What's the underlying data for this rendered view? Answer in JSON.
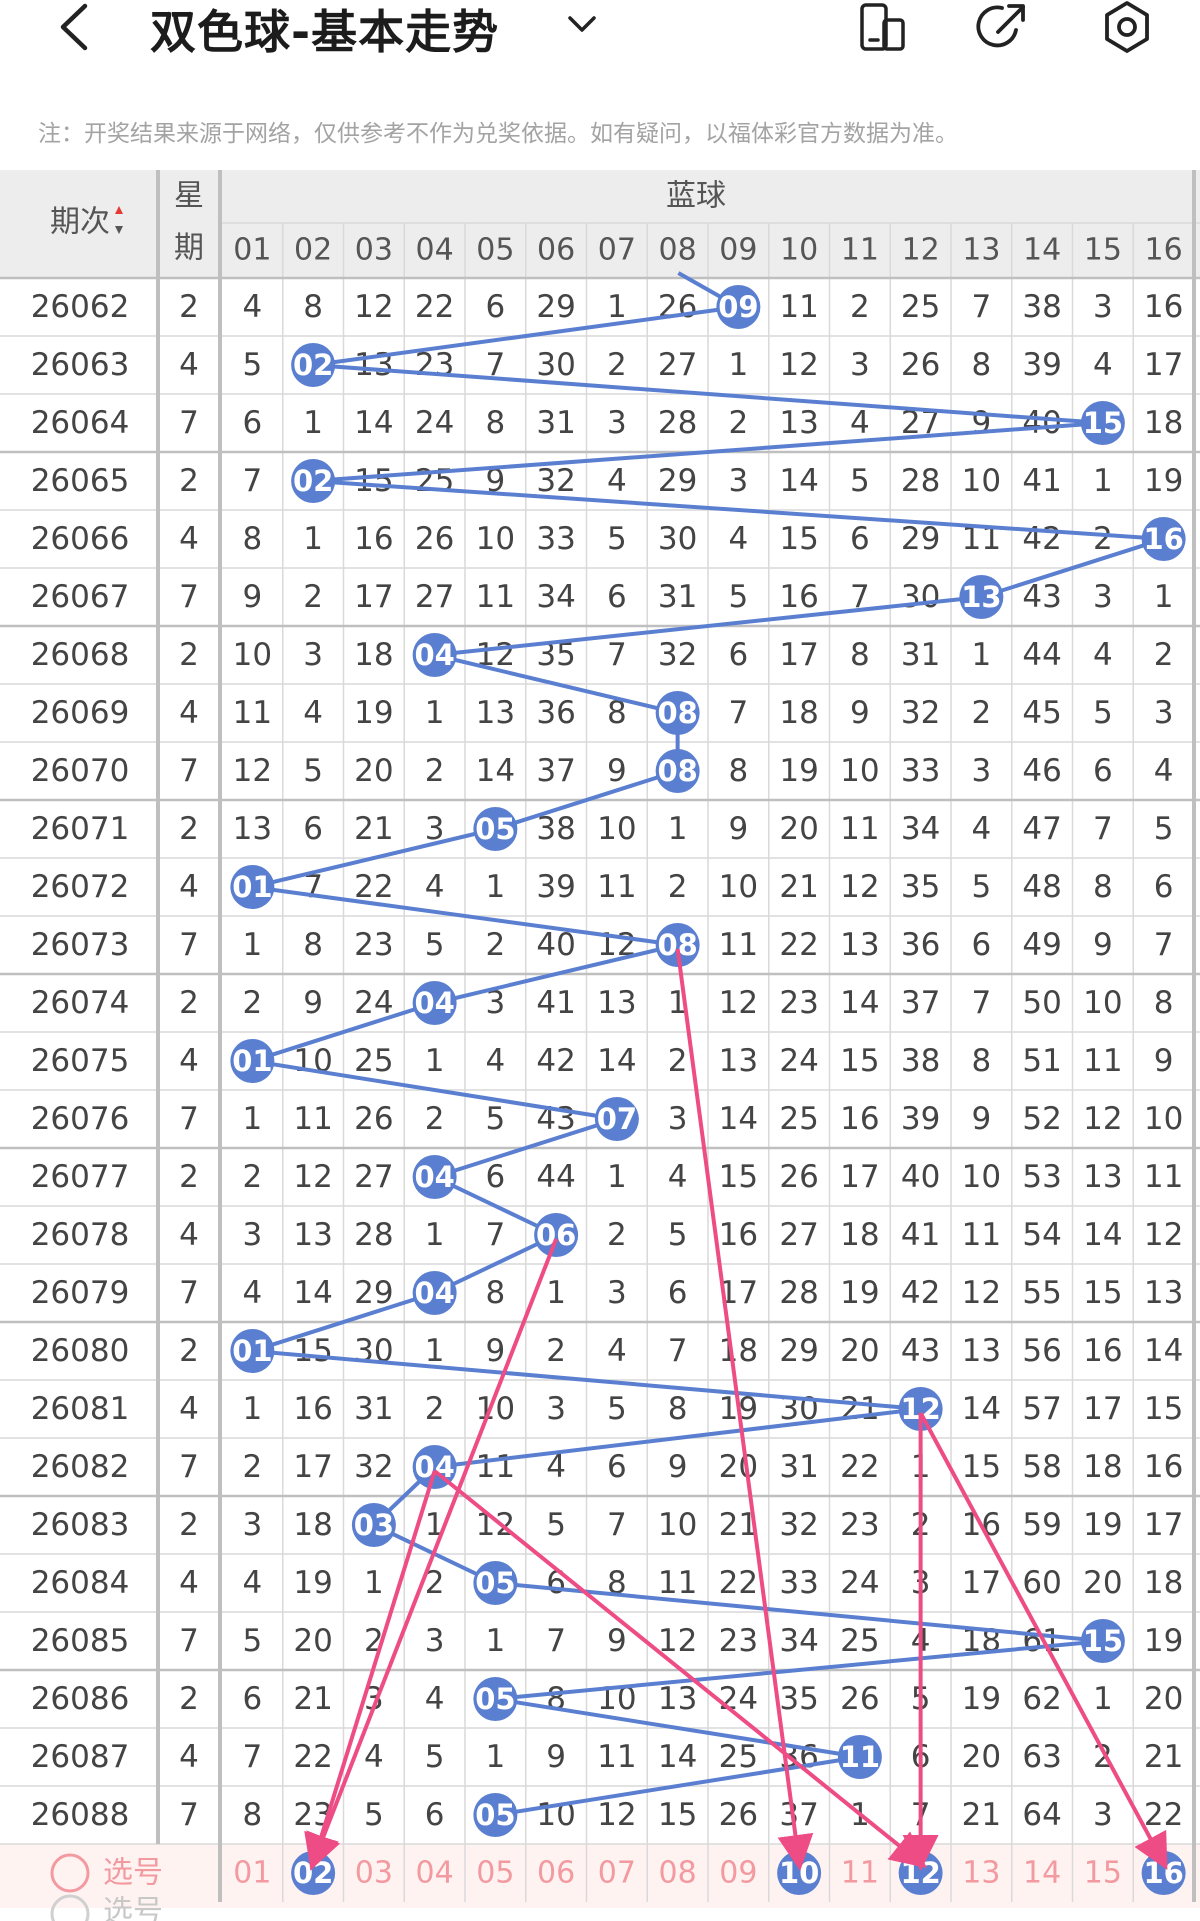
{
  "header": {
    "back_icon": "chevron-left-icon",
    "title": "双色球-基本走势",
    "dropdown_icon": "chevron-down-icon",
    "actions": [
      "phone-layout-icon",
      "share-icon",
      "settings-icon"
    ]
  },
  "notice": "注：开奖结果来源于网络，仅供参考不作为兑奖依据。如有疑问，以福体彩官方数据为准。",
  "table": {
    "col_issue": "期次",
    "col_week_1": "星",
    "col_week_2": "期",
    "group_title": "蓝球",
    "columns": [
      "01",
      "02",
      "03",
      "04",
      "05",
      "06",
      "07",
      "08",
      "09",
      "10",
      "11",
      "12",
      "13",
      "14",
      "15",
      "16"
    ],
    "rows": [
      {
        "issue": "26062",
        "week": "2",
        "cells": [
          "4",
          "8",
          "12",
          "22",
          "6",
          "29",
          "1",
          "26",
          "09",
          "11",
          "2",
          "25",
          "7",
          "38",
          "3",
          "16"
        ],
        "hit": 9
      },
      {
        "issue": "26063",
        "week": "4",
        "cells": [
          "5",
          "02",
          "13",
          "23",
          "7",
          "30",
          "2",
          "27",
          "1",
          "12",
          "3",
          "26",
          "8",
          "39",
          "4",
          "17"
        ],
        "hit": 2
      },
      {
        "issue": "26064",
        "week": "7",
        "cells": [
          "6",
          "1",
          "14",
          "24",
          "8",
          "31",
          "3",
          "28",
          "2",
          "13",
          "4",
          "27",
          "9",
          "40",
          "15",
          "18"
        ],
        "hit": 15
      },
      {
        "issue": "26065",
        "week": "2",
        "cells": [
          "7",
          "02",
          "15",
          "25",
          "9",
          "32",
          "4",
          "29",
          "3",
          "14",
          "5",
          "28",
          "10",
          "41",
          "1",
          "19"
        ],
        "hit": 2
      },
      {
        "issue": "26066",
        "week": "4",
        "cells": [
          "8",
          "1",
          "16",
          "26",
          "10",
          "33",
          "5",
          "30",
          "4",
          "15",
          "6",
          "29",
          "11",
          "42",
          "2",
          "16"
        ],
        "hit": 16
      },
      {
        "issue": "26067",
        "week": "7",
        "cells": [
          "9",
          "2",
          "17",
          "27",
          "11",
          "34",
          "6",
          "31",
          "5",
          "16",
          "7",
          "30",
          "13",
          "43",
          "3",
          "1"
        ],
        "hit": 13
      },
      {
        "issue": "26068",
        "week": "2",
        "cells": [
          "10",
          "3",
          "18",
          "04",
          "12",
          "35",
          "7",
          "32",
          "6",
          "17",
          "8",
          "31",
          "1",
          "44",
          "4",
          "2"
        ],
        "hit": 4
      },
      {
        "issue": "26069",
        "week": "4",
        "cells": [
          "11",
          "4",
          "19",
          "1",
          "13",
          "36",
          "8",
          "08",
          "7",
          "18",
          "9",
          "32",
          "2",
          "45",
          "5",
          "3"
        ],
        "hit": 8
      },
      {
        "issue": "26070",
        "week": "7",
        "cells": [
          "12",
          "5",
          "20",
          "2",
          "14",
          "37",
          "9",
          "08",
          "8",
          "19",
          "10",
          "33",
          "3",
          "46",
          "6",
          "4"
        ],
        "hit": 8
      },
      {
        "issue": "26071",
        "week": "2",
        "cells": [
          "13",
          "6",
          "21",
          "3",
          "05",
          "38",
          "10",
          "1",
          "9",
          "20",
          "11",
          "34",
          "4",
          "47",
          "7",
          "5"
        ],
        "hit": 5
      },
      {
        "issue": "26072",
        "week": "4",
        "cells": [
          "01",
          "7",
          "22",
          "4",
          "1",
          "39",
          "11",
          "2",
          "10",
          "21",
          "12",
          "35",
          "5",
          "48",
          "8",
          "6"
        ],
        "hit": 1
      },
      {
        "issue": "26073",
        "week": "7",
        "cells": [
          "1",
          "8",
          "23",
          "5",
          "2",
          "40",
          "12",
          "08",
          "11",
          "22",
          "13",
          "36",
          "6",
          "49",
          "9",
          "7"
        ],
        "hit": 8
      },
      {
        "issue": "26074",
        "week": "2",
        "cells": [
          "2",
          "9",
          "24",
          "04",
          "3",
          "41",
          "13",
          "1",
          "12",
          "23",
          "14",
          "37",
          "7",
          "50",
          "10",
          "8"
        ],
        "hit": 4
      },
      {
        "issue": "26075",
        "week": "4",
        "cells": [
          "01",
          "10",
          "25",
          "1",
          "4",
          "42",
          "14",
          "2",
          "13",
          "24",
          "15",
          "38",
          "8",
          "51",
          "11",
          "9"
        ],
        "hit": 1
      },
      {
        "issue": "26076",
        "week": "7",
        "cells": [
          "1",
          "11",
          "26",
          "2",
          "5",
          "43",
          "07",
          "3",
          "14",
          "25",
          "16",
          "39",
          "9",
          "52",
          "12",
          "10"
        ],
        "hit": 7
      },
      {
        "issue": "26077",
        "week": "2",
        "cells": [
          "2",
          "12",
          "27",
          "04",
          "6",
          "44",
          "1",
          "4",
          "15",
          "26",
          "17",
          "40",
          "10",
          "53",
          "13",
          "11"
        ],
        "hit": 4
      },
      {
        "issue": "26078",
        "week": "4",
        "cells": [
          "3",
          "13",
          "28",
          "1",
          "7",
          "06",
          "2",
          "5",
          "16",
          "27",
          "18",
          "41",
          "11",
          "54",
          "14",
          "12"
        ],
        "hit": 6
      },
      {
        "issue": "26079",
        "week": "7",
        "cells": [
          "4",
          "14",
          "29",
          "04",
          "8",
          "1",
          "3",
          "6",
          "17",
          "28",
          "19",
          "42",
          "12",
          "55",
          "15",
          "13"
        ],
        "hit": 4
      },
      {
        "issue": "26080",
        "week": "2",
        "cells": [
          "01",
          "15",
          "30",
          "1",
          "9",
          "2",
          "4",
          "7",
          "18",
          "29",
          "20",
          "43",
          "13",
          "56",
          "16",
          "14"
        ],
        "hit": 1
      },
      {
        "issue": "26081",
        "week": "4",
        "cells": [
          "1",
          "16",
          "31",
          "2",
          "10",
          "3",
          "5",
          "8",
          "19",
          "30",
          "21",
          "12",
          "14",
          "57",
          "17",
          "15"
        ],
        "hit": 12
      },
      {
        "issue": "26082",
        "week": "7",
        "cells": [
          "2",
          "17",
          "32",
          "04",
          "11",
          "4",
          "6",
          "9",
          "20",
          "31",
          "22",
          "1",
          "15",
          "58",
          "18",
          "16"
        ],
        "hit": 4
      },
      {
        "issue": "26083",
        "week": "2",
        "cells": [
          "3",
          "18",
          "03",
          "1",
          "12",
          "5",
          "7",
          "10",
          "21",
          "32",
          "23",
          "2",
          "16",
          "59",
          "19",
          "17"
        ],
        "hit": 3
      },
      {
        "issue": "26084",
        "week": "4",
        "cells": [
          "4",
          "19",
          "1",
          "2",
          "05",
          "6",
          "8",
          "11",
          "22",
          "33",
          "24",
          "3",
          "17",
          "60",
          "20",
          "18"
        ],
        "hit": 5
      },
      {
        "issue": "26085",
        "week": "7",
        "cells": [
          "5",
          "20",
          "2",
          "3",
          "1",
          "7",
          "9",
          "12",
          "23",
          "34",
          "25",
          "4",
          "18",
          "61",
          "15",
          "19"
        ],
        "hit": 15
      },
      {
        "issue": "26086",
        "week": "2",
        "cells": [
          "6",
          "21",
          "3",
          "4",
          "05",
          "8",
          "10",
          "13",
          "24",
          "35",
          "26",
          "5",
          "19",
          "62",
          "1",
          "20"
        ],
        "hit": 5
      },
      {
        "issue": "26087",
        "week": "4",
        "cells": [
          "7",
          "22",
          "4",
          "5",
          "1",
          "9",
          "11",
          "14",
          "25",
          "36",
          "11",
          "6",
          "20",
          "63",
          "2",
          "21"
        ],
        "hit": 11
      },
      {
        "issue": "26088",
        "week": "7",
        "cells": [
          "8",
          "23",
          "5",
          "6",
          "05",
          "10",
          "12",
          "15",
          "26",
          "37",
          "1",
          "7",
          "21",
          "64",
          "3",
          "22"
        ],
        "hit": 5
      }
    ],
    "select_label": "选号",
    "select_row": [
      "01",
      "02",
      "03",
      "04",
      "05",
      "06",
      "07",
      "08",
      "09",
      "10",
      "11",
      "12",
      "13",
      "14",
      "15",
      "16"
    ],
    "selected": [
      2,
      10,
      12,
      16
    ],
    "partial_label": "选号"
  },
  "colors": {
    "ball": "#5b7fd0",
    "line": "#5b7fd0",
    "arrow": "#ee4c84",
    "select_text": "#f29aa0",
    "select_bg": "#fff3f2",
    "grid_line": "#d9d9d9",
    "thick_line": "#bfbfbf",
    "header_bg": "#ededed"
  }
}
